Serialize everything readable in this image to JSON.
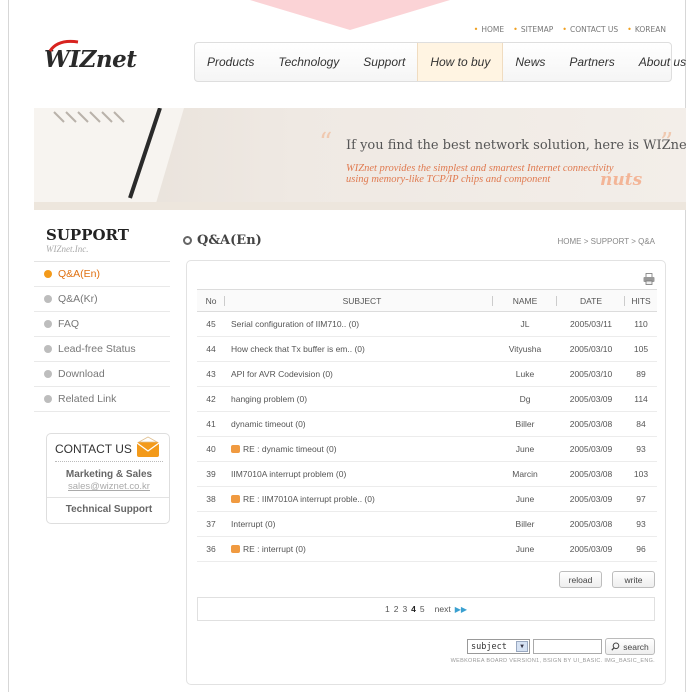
{
  "header": {
    "logo": "WIZnet",
    "top_links": [
      "HOME",
      "SITEMAP",
      "CONTACT US",
      "KOREAN"
    ],
    "nav": [
      {
        "label": "Products"
      },
      {
        "label": "Technology"
      },
      {
        "label": "Support"
      },
      {
        "label": "How to buy",
        "active": true
      },
      {
        "label": "News"
      },
      {
        "label": "Partners"
      },
      {
        "label": "About us"
      }
    ]
  },
  "banner": {
    "tagline": "If you find the best network solution, here is WIZnet.",
    "subline_1": "WIZnet provides the simplest and smartest Internet connectivity",
    "subline_2": "using memory-like TCP/IP chips and component",
    "nuts": "nuts"
  },
  "sidebar": {
    "title": "SUPPORT",
    "subtitle": "WIZnet.Inc.",
    "items": [
      {
        "label": "Q&A(En)",
        "active": true
      },
      {
        "label": "Q&A(Kr)"
      },
      {
        "label": "FAQ"
      },
      {
        "label": "Lead-free Status"
      },
      {
        "label": "Download"
      },
      {
        "label": "Related Link"
      }
    ],
    "contact": {
      "title": "CONTACT US",
      "marketing_label": "Marketing & Sales",
      "marketing_email": "sales@wiznet.co.kr",
      "tech_label": "Technical Support"
    }
  },
  "main": {
    "title": "Q&A(En)",
    "breadcrumb": "HOME > SUPPORT > Q&A",
    "columns": {
      "no": "No",
      "subject": "SUBJECT",
      "name": "NAME",
      "date": "DATE",
      "hits": "HITS"
    },
    "rows": [
      {
        "no": "45",
        "subject": "Serial configuration of IIM710.. (0)",
        "name": "JL",
        "date": "2005/03/11",
        "hits": "110",
        "reply": false
      },
      {
        "no": "44",
        "subject": "How check that Tx buffer is em.. (0)",
        "name": "Vityusha",
        "date": "2005/03/10",
        "hits": "105",
        "reply": false
      },
      {
        "no": "43",
        "subject": "API for AVR Codevision (0)",
        "name": "Luke",
        "date": "2005/03/10",
        "hits": "89",
        "reply": false
      },
      {
        "no": "42",
        "subject": "hanging problem (0)",
        "name": "Dg",
        "date": "2005/03/09",
        "hits": "114",
        "reply": false
      },
      {
        "no": "41",
        "subject": "dynamic timeout (0)",
        "name": "Biller",
        "date": "2005/03/08",
        "hits": "84",
        "reply": false
      },
      {
        "no": "40",
        "subject": "RE : dynamic timeout (0)",
        "name": "June",
        "date": "2005/03/09",
        "hits": "93",
        "reply": true
      },
      {
        "no": "39",
        "subject": "IIM7010A interrupt problem (0)",
        "name": "Marcin",
        "date": "2005/03/08",
        "hits": "103",
        "reply": false
      },
      {
        "no": "38",
        "subject": "RE : IIM7010A interrupt proble.. (0)",
        "name": "June",
        "date": "2005/03/09",
        "hits": "97",
        "reply": true
      },
      {
        "no": "37",
        "subject": "Interrupt (0)",
        "name": "Biller",
        "date": "2005/03/08",
        "hits": "93",
        "reply": false
      },
      {
        "no": "36",
        "subject": "RE : interrupt (0)",
        "name": "June",
        "date": "2005/03/09",
        "hits": "96",
        "reply": true
      }
    ],
    "buttons": {
      "reload": "reload",
      "write": "write"
    },
    "pagination": {
      "pages": [
        "1",
        "2",
        "3",
        "4",
        "5"
      ],
      "current": "4",
      "next": "next"
    },
    "search": {
      "field": "subject",
      "button": "search"
    },
    "credit": "WEBKOREA BOARD VERSION1, BSIGN BY UI_BASIC. IMG_BASIC_ENG."
  }
}
